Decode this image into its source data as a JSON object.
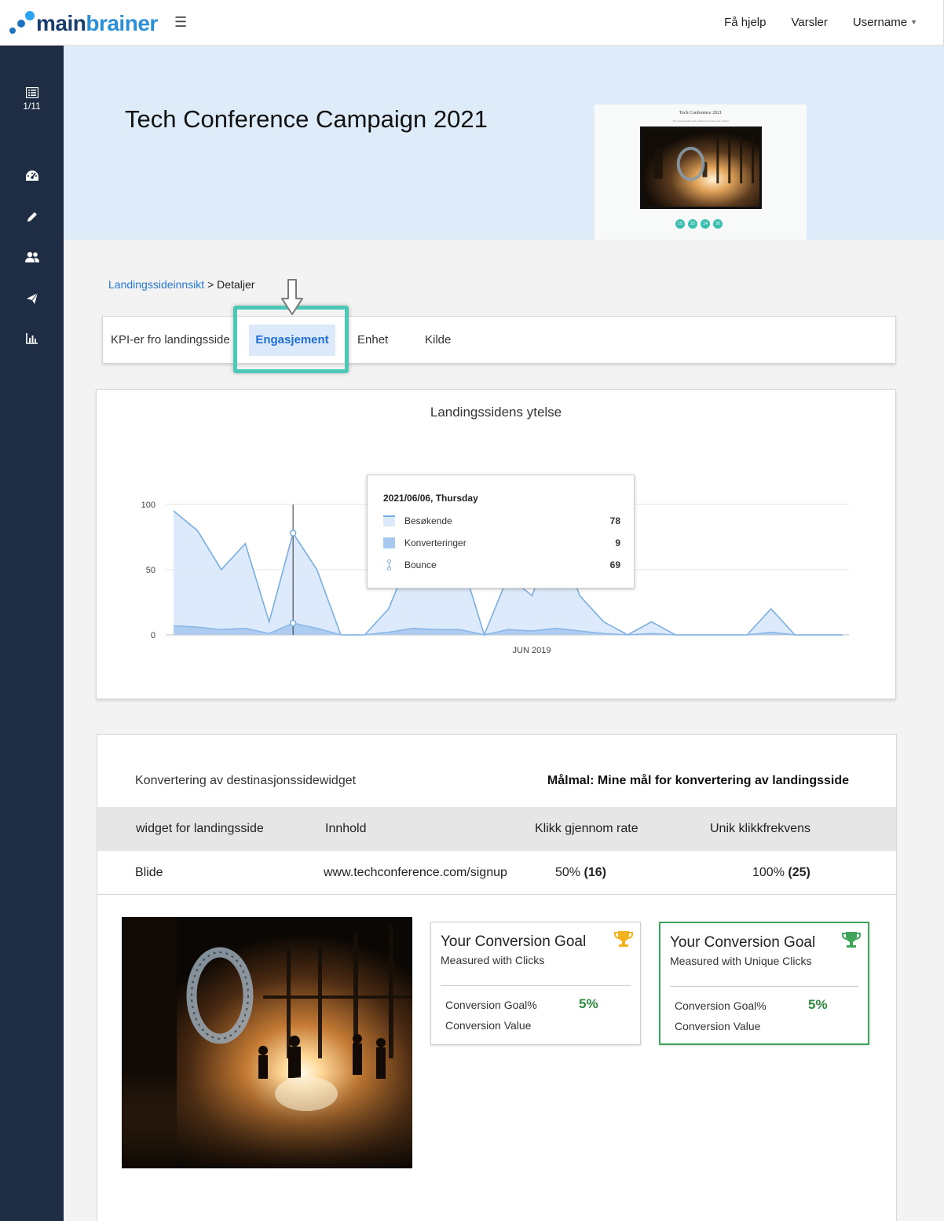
{
  "header": {
    "logo_main": "main",
    "logo_brain": "brainer",
    "nav": [
      "Få hjelp",
      "Varsler"
    ],
    "user": "Username"
  },
  "sidebar": {
    "page_counter": "1/11",
    "icons": [
      "list-icon",
      "dashboard-icon",
      "pencil-icon",
      "users-icon",
      "send-icon",
      "bar-chart-icon"
    ]
  },
  "hero": {
    "title": "Tech Conference Campaign 2021",
    "thumb_title": "Tech Conference 2021",
    "thumb_sub": "The most awaited tech conference of the year is here!",
    "thumb_countdown": [
      "15",
      "23",
      "14",
      "30"
    ]
  },
  "breadcrumb": {
    "link": "Landingssideinnsikt",
    "separator": " > ",
    "current": "Detaljer"
  },
  "tabs": {
    "kpi": "KPI-er fro landingsside",
    "engagement": "Engasjement",
    "device": "Enhet",
    "source": "Kilde",
    "active": "Engasjement"
  },
  "chart_data": {
    "type": "area",
    "title": "Landingssidens ytelse",
    "x_label_center": "JUN 2019",
    "yticks": [
      0,
      50,
      100
    ],
    "ylim": [
      0,
      100
    ],
    "grid": true,
    "series": [
      {
        "name": "Besøkende",
        "color": "#dbe9fb",
        "values": [
          95,
          80,
          50,
          70,
          10,
          78,
          50,
          0,
          0,
          20,
          65,
          85,
          60,
          0,
          45,
          30,
          80,
          30,
          10,
          0,
          10,
          0,
          0,
          0,
          0,
          20,
          0,
          0,
          0
        ]
      },
      {
        "name": "Konverteringer",
        "color": "#a8c9ee",
        "values": [
          7,
          6,
          4,
          5,
          1,
          9,
          5,
          0,
          0,
          2,
          5,
          4,
          4,
          0,
          4,
          3,
          5,
          3,
          1,
          0,
          1,
          0,
          0,
          0,
          0,
          2,
          0,
          0,
          0
        ]
      }
    ],
    "tooltip": {
      "date": "2021/06/06, Thursday",
      "rows": [
        {
          "label": "Besøkende",
          "value": "78",
          "color": "#dbe9fb"
        },
        {
          "label": "Konverteringer",
          "value": "9",
          "color": "#a8c9ee"
        },
        {
          "label": "Bounce",
          "value": "69",
          "color": "#7aaedf"
        }
      ]
    }
  },
  "widget_section": {
    "heading": "Konvertering av destinasjonssidewidget",
    "goal": "Målmal: Mine mål for konvertering av landingsside",
    "columns": [
      "widget for landingsside",
      "Innhold",
      "Klikk gjennom rate",
      "Unik klikkfrekvens"
    ],
    "rows": [
      {
        "widget": "Blide",
        "content": "www.techconference.com/signup",
        "ctr_pct": "50%",
        "ctr_count": "(16)",
        "unique_pct": "100%",
        "unique_count": "(25)"
      }
    ]
  },
  "goal_cards": [
    {
      "title": "Your Conversion Goal",
      "subtitle": "Measured with Clicks",
      "label_goal": "Conversion Goal%",
      "value_goal": "5%",
      "label_value": "Conversion Value",
      "trophy_color": "#f2b21c"
    },
    {
      "title": "Your Conversion Goal",
      "subtitle": "Measured with Unique Clicks",
      "label_goal": "Conversion Goal%",
      "value_goal": "5%",
      "label_value": "Conversion Value",
      "trophy_color": "#3ea55a"
    }
  ]
}
